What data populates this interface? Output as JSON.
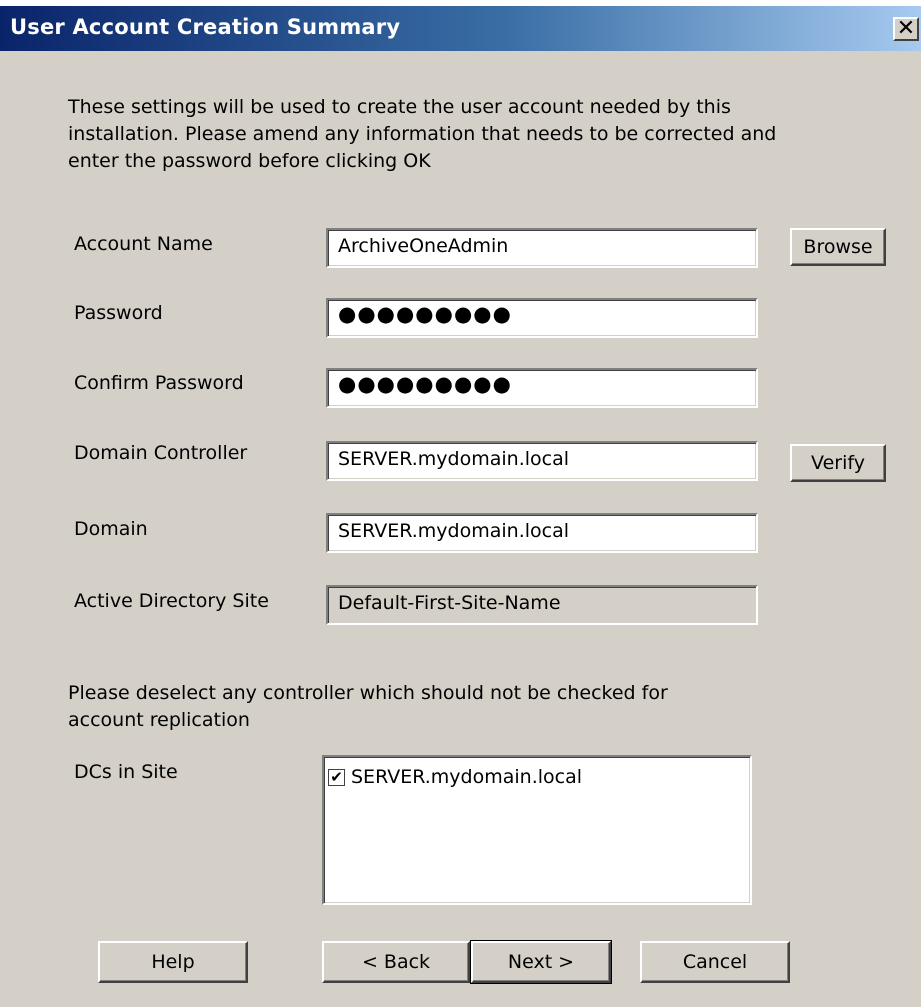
{
  "dialog": {
    "title": "User Account Creation Summary",
    "close_glyph": "✕",
    "intro_text": "These settings will be used to create the user account needed by this installation. Please amend any information that needs to be corrected and enter the password before clicking OK"
  },
  "form": {
    "account_name": {
      "label": "Account Name",
      "value": "ArchiveOneAdmin",
      "button": "Browse"
    },
    "password": {
      "label": "Password",
      "value": "●●●●●●●●●"
    },
    "confirm_password": {
      "label": "Confirm Password",
      "value": "●●●●●●●●●"
    },
    "domain_controller": {
      "label": "Domain Controller",
      "value": "SERVER.mydomain.local",
      "button": "Verify"
    },
    "domain": {
      "label": "Domain",
      "value": "SERVER.mydomain.local"
    },
    "ad_site": {
      "label": "Active Directory  Site",
      "value": "Default-First-Site-Name"
    }
  },
  "replication": {
    "text": "Please deselect any controller which should not be checked for account replication",
    "dcs_label": "DCs in Site",
    "items": [
      {
        "label": "SERVER.mydomain.local",
        "checked": true,
        "check_glyph": "✔"
      }
    ]
  },
  "buttons": {
    "help": "Help",
    "back": "< Back",
    "next": "Next >",
    "cancel": "Cancel"
  },
  "colors": {
    "titlebar_start": "#0a246a",
    "titlebar_end": "#a6caf0",
    "dialog_face": "#d4d0c8"
  }
}
